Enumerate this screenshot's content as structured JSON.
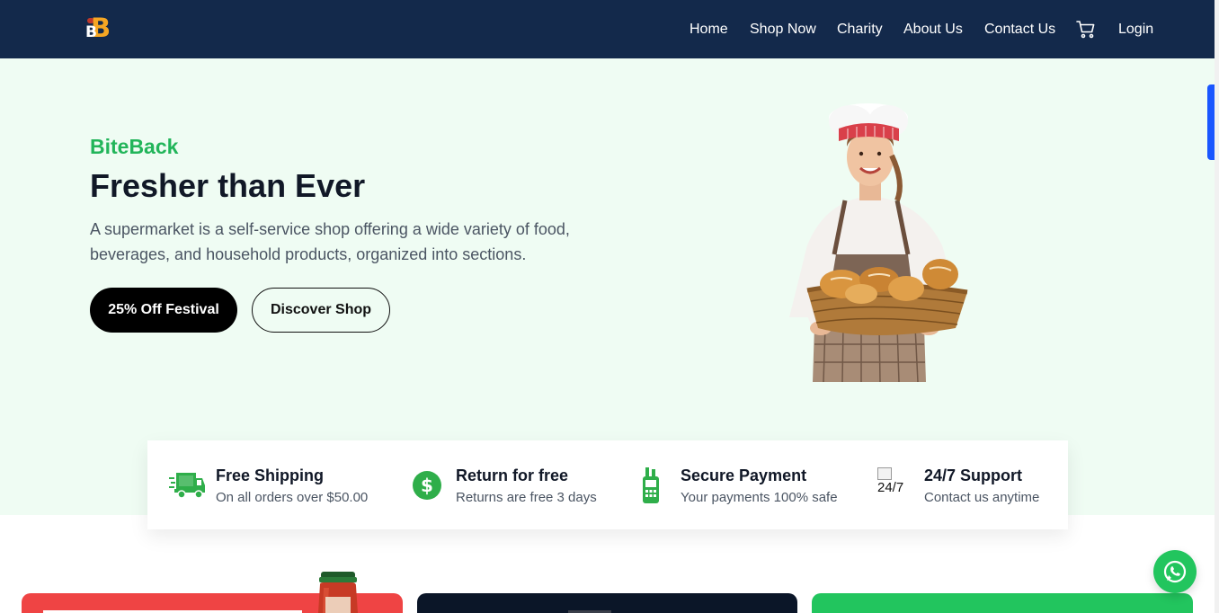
{
  "header": {
    "logo_alt": "BiteBack logo",
    "nav": [
      {
        "label": "Home"
      },
      {
        "label": "Shop Now"
      },
      {
        "label": "Charity"
      },
      {
        "label": "About Us"
      },
      {
        "label": "Contact Us"
      }
    ],
    "cart_icon": "cart-icon",
    "login_label": "Login"
  },
  "hero": {
    "brand": "BiteBack",
    "headline": "Fresher than Ever",
    "description": "A supermarket is a self-service shop offering a wide variety of food, beverages, and household products, organized into sections.",
    "primary_button": "25% Off Festival",
    "secondary_button": "Discover Shop",
    "image": "chef-with-bread-basket"
  },
  "features": [
    {
      "title": "Free Shipping",
      "subtitle": "On all orders over $50.00",
      "icon": "delivery-truck-icon"
    },
    {
      "title": "Return for free",
      "subtitle": "Returns are free 3 days",
      "icon": "dollar-circle-icon"
    },
    {
      "title": "Secure Payment",
      "subtitle": "Your payments 100% safe",
      "icon": "payment-terminal-icon"
    },
    {
      "title": "24/7 Support",
      "subtitle": "Contact us anytime",
      "icon": "support-icon",
      "broken_alt": "24/7"
    }
  ],
  "colors": {
    "navbar": "#13294b",
    "accent_green": "#22b55a",
    "hero_bg": "#effcf3",
    "card_red": "#ef4444",
    "card_navy": "#0b1628",
    "card_green": "#22c55e"
  },
  "floating": {
    "whatsapp_icon": "whatsapp-icon"
  }
}
